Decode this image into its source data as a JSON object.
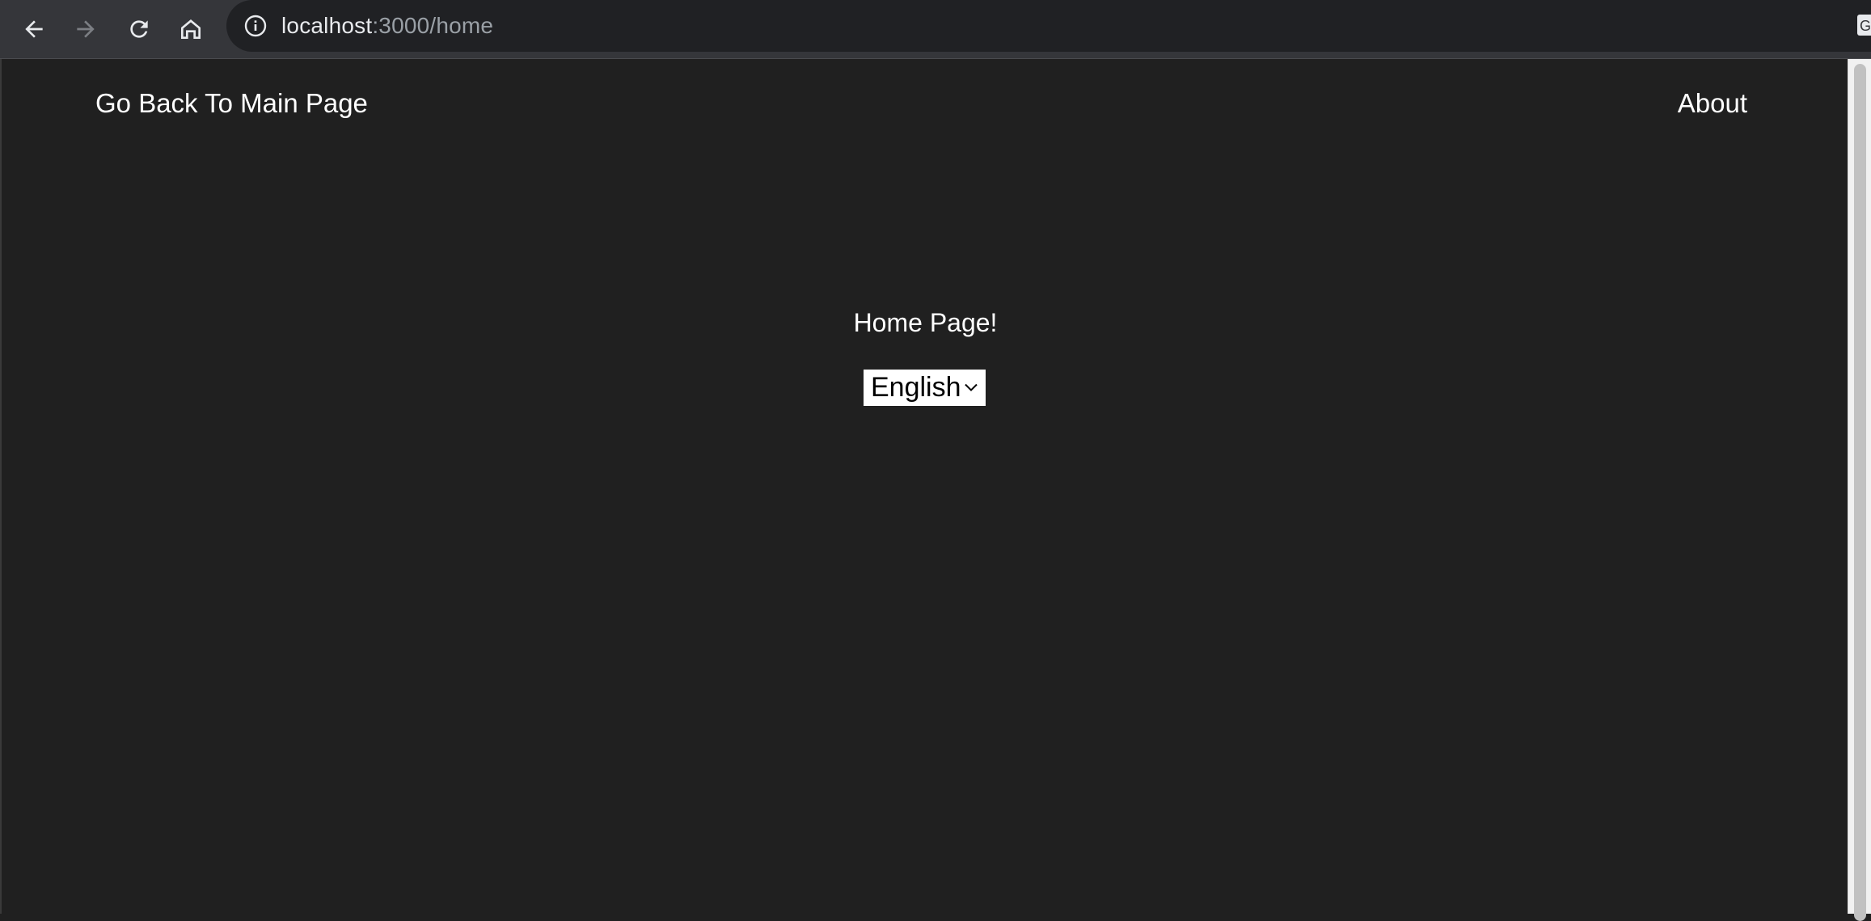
{
  "browser": {
    "url_host": "localhost",
    "url_path": ":3000/home",
    "icons": [
      "back-arrow-icon",
      "forward-arrow-icon",
      "reload-icon",
      "home-icon",
      "info-icon",
      "translate-extension-icon"
    ]
  },
  "header": {
    "back_link": "Go Back To Main Page",
    "about_link": "About"
  },
  "main": {
    "title": "Home Page!",
    "language_select": {
      "selected": "English"
    }
  },
  "colors": {
    "page_background": "#202020",
    "toolbar_background": "#35363a",
    "omnibox_background": "#202124",
    "text": "#ffffff"
  }
}
